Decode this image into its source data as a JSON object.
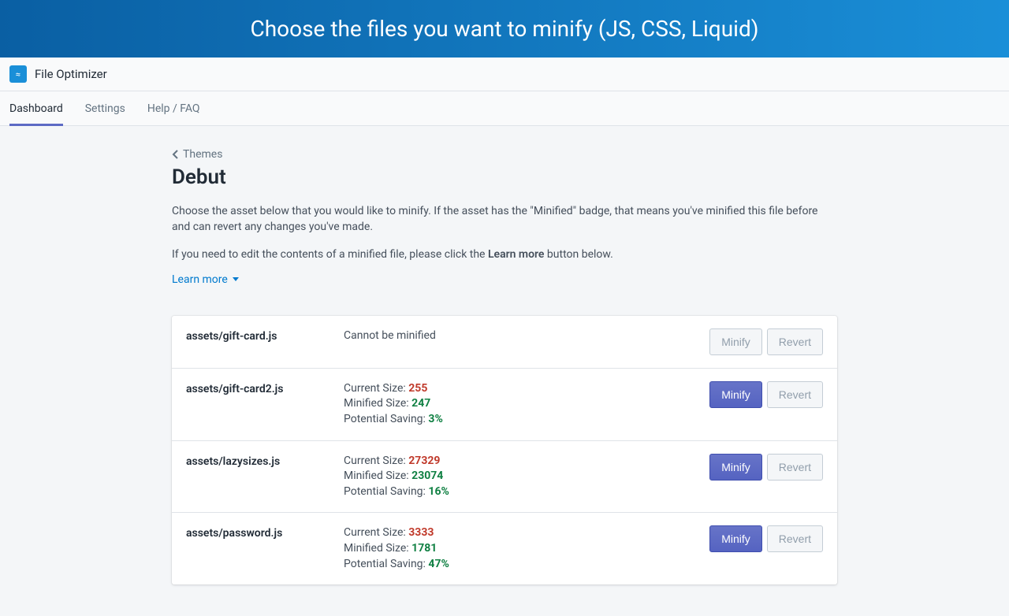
{
  "banner": {
    "headline": "Choose the files you want to minify (JS, CSS, Liquid)"
  },
  "app": {
    "name": "File Optimizer"
  },
  "tabs": [
    {
      "label": "Dashboard",
      "active": true
    },
    {
      "label": "Settings",
      "active": false
    },
    {
      "label": "Help / FAQ",
      "active": false
    }
  ],
  "breadcrumb": {
    "label": "Themes"
  },
  "page": {
    "title": "Debut",
    "intro1": "Choose the asset below that you would like to minify. If the asset has the \"Minified\" badge, that means you've minified this file before and can revert any changes you've made.",
    "intro2_pre": "If you need to edit the contents of a minified file, please click the ",
    "intro2_strong": "Learn more",
    "intro2_post": " button below.",
    "learn_more": "Learn more"
  },
  "labels": {
    "current_size": "Current Size: ",
    "minified_size": "Minified Size: ",
    "potential_saving": "Potential Saving: ",
    "cannot_minify": "Cannot be minified",
    "minify": "Minify",
    "revert": "Revert"
  },
  "assets": [
    {
      "name": "assets/gift-card.js",
      "status": "cannot",
      "minify_enabled": false,
      "revert_enabled": false
    },
    {
      "name": "assets/gift-card2.js",
      "status": "ok",
      "current": "255",
      "minified": "247",
      "saving": "3%",
      "minify_enabled": true,
      "revert_enabled": false
    },
    {
      "name": "assets/lazysizes.js",
      "status": "ok",
      "current": "27329",
      "minified": "23074",
      "saving": "16%",
      "minify_enabled": true,
      "revert_enabled": false
    },
    {
      "name": "assets/password.js",
      "status": "ok",
      "current": "3333",
      "minified": "1781",
      "saving": "47%",
      "minify_enabled": true,
      "revert_enabled": false
    }
  ]
}
